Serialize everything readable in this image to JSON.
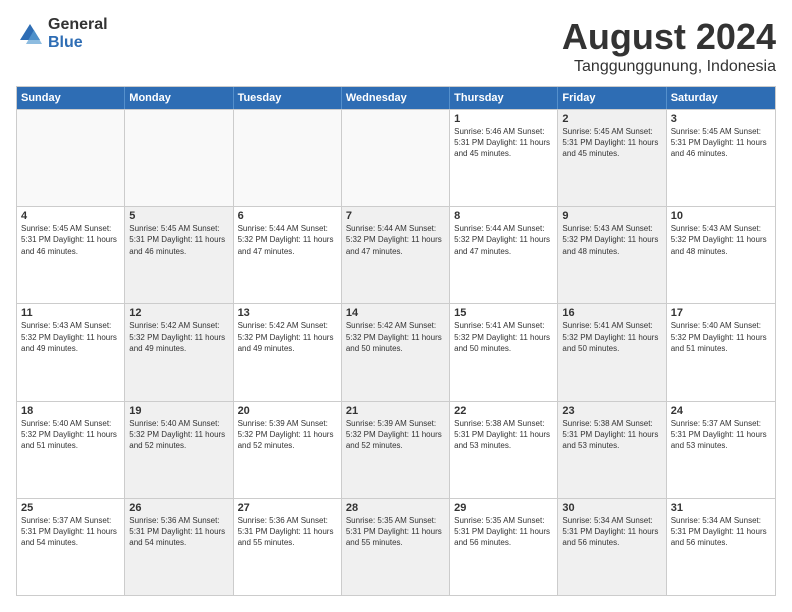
{
  "logo": {
    "general": "General",
    "blue": "Blue"
  },
  "title": "August 2024",
  "subtitle": "Tanggunggunung, Indonesia",
  "header_days": [
    "Sunday",
    "Monday",
    "Tuesday",
    "Wednesday",
    "Thursday",
    "Friday",
    "Saturday"
  ],
  "rows": [
    [
      {
        "day": "",
        "info": "",
        "empty": true
      },
      {
        "day": "",
        "info": "",
        "empty": true
      },
      {
        "day": "",
        "info": "",
        "empty": true
      },
      {
        "day": "",
        "info": "",
        "empty": true
      },
      {
        "day": "1",
        "info": "Sunrise: 5:46 AM\nSunset: 5:31 PM\nDaylight: 11 hours\nand 45 minutes."
      },
      {
        "day": "2",
        "info": "Sunrise: 5:45 AM\nSunset: 5:31 PM\nDaylight: 11 hours\nand 45 minutes.",
        "shaded": true
      },
      {
        "day": "3",
        "info": "Sunrise: 5:45 AM\nSunset: 5:31 PM\nDaylight: 11 hours\nand 46 minutes."
      }
    ],
    [
      {
        "day": "4",
        "info": "Sunrise: 5:45 AM\nSunset: 5:31 PM\nDaylight: 11 hours\nand 46 minutes."
      },
      {
        "day": "5",
        "info": "Sunrise: 5:45 AM\nSunset: 5:31 PM\nDaylight: 11 hours\nand 46 minutes.",
        "shaded": true
      },
      {
        "day": "6",
        "info": "Sunrise: 5:44 AM\nSunset: 5:32 PM\nDaylight: 11 hours\nand 47 minutes."
      },
      {
        "day": "7",
        "info": "Sunrise: 5:44 AM\nSunset: 5:32 PM\nDaylight: 11 hours\nand 47 minutes.",
        "shaded": true
      },
      {
        "day": "8",
        "info": "Sunrise: 5:44 AM\nSunset: 5:32 PM\nDaylight: 11 hours\nand 47 minutes."
      },
      {
        "day": "9",
        "info": "Sunrise: 5:43 AM\nSunset: 5:32 PM\nDaylight: 11 hours\nand 48 minutes.",
        "shaded": true
      },
      {
        "day": "10",
        "info": "Sunrise: 5:43 AM\nSunset: 5:32 PM\nDaylight: 11 hours\nand 48 minutes."
      }
    ],
    [
      {
        "day": "11",
        "info": "Sunrise: 5:43 AM\nSunset: 5:32 PM\nDaylight: 11 hours\nand 49 minutes."
      },
      {
        "day": "12",
        "info": "Sunrise: 5:42 AM\nSunset: 5:32 PM\nDaylight: 11 hours\nand 49 minutes.",
        "shaded": true
      },
      {
        "day": "13",
        "info": "Sunrise: 5:42 AM\nSunset: 5:32 PM\nDaylight: 11 hours\nand 49 minutes."
      },
      {
        "day": "14",
        "info": "Sunrise: 5:42 AM\nSunset: 5:32 PM\nDaylight: 11 hours\nand 50 minutes.",
        "shaded": true
      },
      {
        "day": "15",
        "info": "Sunrise: 5:41 AM\nSunset: 5:32 PM\nDaylight: 11 hours\nand 50 minutes."
      },
      {
        "day": "16",
        "info": "Sunrise: 5:41 AM\nSunset: 5:32 PM\nDaylight: 11 hours\nand 50 minutes.",
        "shaded": true
      },
      {
        "day": "17",
        "info": "Sunrise: 5:40 AM\nSunset: 5:32 PM\nDaylight: 11 hours\nand 51 minutes."
      }
    ],
    [
      {
        "day": "18",
        "info": "Sunrise: 5:40 AM\nSunset: 5:32 PM\nDaylight: 11 hours\nand 51 minutes."
      },
      {
        "day": "19",
        "info": "Sunrise: 5:40 AM\nSunset: 5:32 PM\nDaylight: 11 hours\nand 52 minutes.",
        "shaded": true
      },
      {
        "day": "20",
        "info": "Sunrise: 5:39 AM\nSunset: 5:32 PM\nDaylight: 11 hours\nand 52 minutes."
      },
      {
        "day": "21",
        "info": "Sunrise: 5:39 AM\nSunset: 5:32 PM\nDaylight: 11 hours\nand 52 minutes.",
        "shaded": true
      },
      {
        "day": "22",
        "info": "Sunrise: 5:38 AM\nSunset: 5:31 PM\nDaylight: 11 hours\nand 53 minutes."
      },
      {
        "day": "23",
        "info": "Sunrise: 5:38 AM\nSunset: 5:31 PM\nDaylight: 11 hours\nand 53 minutes.",
        "shaded": true
      },
      {
        "day": "24",
        "info": "Sunrise: 5:37 AM\nSunset: 5:31 PM\nDaylight: 11 hours\nand 53 minutes."
      }
    ],
    [
      {
        "day": "25",
        "info": "Sunrise: 5:37 AM\nSunset: 5:31 PM\nDaylight: 11 hours\nand 54 minutes."
      },
      {
        "day": "26",
        "info": "Sunrise: 5:36 AM\nSunset: 5:31 PM\nDaylight: 11 hours\nand 54 minutes.",
        "shaded": true
      },
      {
        "day": "27",
        "info": "Sunrise: 5:36 AM\nSunset: 5:31 PM\nDaylight: 11 hours\nand 55 minutes."
      },
      {
        "day": "28",
        "info": "Sunrise: 5:35 AM\nSunset: 5:31 PM\nDaylight: 11 hours\nand 55 minutes.",
        "shaded": true
      },
      {
        "day": "29",
        "info": "Sunrise: 5:35 AM\nSunset: 5:31 PM\nDaylight: 11 hours\nand 56 minutes."
      },
      {
        "day": "30",
        "info": "Sunrise: 5:34 AM\nSunset: 5:31 PM\nDaylight: 11 hours\nand 56 minutes.",
        "shaded": true
      },
      {
        "day": "31",
        "info": "Sunrise: 5:34 AM\nSunset: 5:31 PM\nDaylight: 11 hours\nand 56 minutes."
      }
    ]
  ]
}
